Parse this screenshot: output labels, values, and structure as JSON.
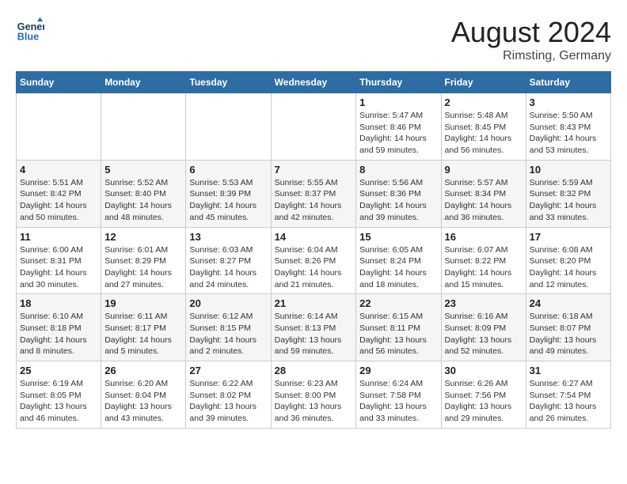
{
  "header": {
    "logo_line1": "General",
    "logo_line2": "Blue",
    "title": "August 2024",
    "subtitle": "Rimsting, Germany"
  },
  "weekdays": [
    "Sunday",
    "Monday",
    "Tuesday",
    "Wednesday",
    "Thursday",
    "Friday",
    "Saturday"
  ],
  "weeks": [
    [
      {
        "day": "",
        "info": ""
      },
      {
        "day": "",
        "info": ""
      },
      {
        "day": "",
        "info": ""
      },
      {
        "day": "",
        "info": ""
      },
      {
        "day": "1",
        "info": "Sunrise: 5:47 AM\nSunset: 8:46 PM\nDaylight: 14 hours\nand 59 minutes."
      },
      {
        "day": "2",
        "info": "Sunrise: 5:48 AM\nSunset: 8:45 PM\nDaylight: 14 hours\nand 56 minutes."
      },
      {
        "day": "3",
        "info": "Sunrise: 5:50 AM\nSunset: 8:43 PM\nDaylight: 14 hours\nand 53 minutes."
      }
    ],
    [
      {
        "day": "4",
        "info": "Sunrise: 5:51 AM\nSunset: 8:42 PM\nDaylight: 14 hours\nand 50 minutes."
      },
      {
        "day": "5",
        "info": "Sunrise: 5:52 AM\nSunset: 8:40 PM\nDaylight: 14 hours\nand 48 minutes."
      },
      {
        "day": "6",
        "info": "Sunrise: 5:53 AM\nSunset: 8:39 PM\nDaylight: 14 hours\nand 45 minutes."
      },
      {
        "day": "7",
        "info": "Sunrise: 5:55 AM\nSunset: 8:37 PM\nDaylight: 14 hours\nand 42 minutes."
      },
      {
        "day": "8",
        "info": "Sunrise: 5:56 AM\nSunset: 8:36 PM\nDaylight: 14 hours\nand 39 minutes."
      },
      {
        "day": "9",
        "info": "Sunrise: 5:57 AM\nSunset: 8:34 PM\nDaylight: 14 hours\nand 36 minutes."
      },
      {
        "day": "10",
        "info": "Sunrise: 5:59 AM\nSunset: 8:32 PM\nDaylight: 14 hours\nand 33 minutes."
      }
    ],
    [
      {
        "day": "11",
        "info": "Sunrise: 6:00 AM\nSunset: 8:31 PM\nDaylight: 14 hours\nand 30 minutes."
      },
      {
        "day": "12",
        "info": "Sunrise: 6:01 AM\nSunset: 8:29 PM\nDaylight: 14 hours\nand 27 minutes."
      },
      {
        "day": "13",
        "info": "Sunrise: 6:03 AM\nSunset: 8:27 PM\nDaylight: 14 hours\nand 24 minutes."
      },
      {
        "day": "14",
        "info": "Sunrise: 6:04 AM\nSunset: 8:26 PM\nDaylight: 14 hours\nand 21 minutes."
      },
      {
        "day": "15",
        "info": "Sunrise: 6:05 AM\nSunset: 8:24 PM\nDaylight: 14 hours\nand 18 minutes."
      },
      {
        "day": "16",
        "info": "Sunrise: 6:07 AM\nSunset: 8:22 PM\nDaylight: 14 hours\nand 15 minutes."
      },
      {
        "day": "17",
        "info": "Sunrise: 6:08 AM\nSunset: 8:20 PM\nDaylight: 14 hours\nand 12 minutes."
      }
    ],
    [
      {
        "day": "18",
        "info": "Sunrise: 6:10 AM\nSunset: 8:18 PM\nDaylight: 14 hours\nand 8 minutes."
      },
      {
        "day": "19",
        "info": "Sunrise: 6:11 AM\nSunset: 8:17 PM\nDaylight: 14 hours\nand 5 minutes."
      },
      {
        "day": "20",
        "info": "Sunrise: 6:12 AM\nSunset: 8:15 PM\nDaylight: 14 hours\nand 2 minutes."
      },
      {
        "day": "21",
        "info": "Sunrise: 6:14 AM\nSunset: 8:13 PM\nDaylight: 13 hours\nand 59 minutes."
      },
      {
        "day": "22",
        "info": "Sunrise: 6:15 AM\nSunset: 8:11 PM\nDaylight: 13 hours\nand 56 minutes."
      },
      {
        "day": "23",
        "info": "Sunrise: 6:16 AM\nSunset: 8:09 PM\nDaylight: 13 hours\nand 52 minutes."
      },
      {
        "day": "24",
        "info": "Sunrise: 6:18 AM\nSunset: 8:07 PM\nDaylight: 13 hours\nand 49 minutes."
      }
    ],
    [
      {
        "day": "25",
        "info": "Sunrise: 6:19 AM\nSunset: 8:05 PM\nDaylight: 13 hours\nand 46 minutes."
      },
      {
        "day": "26",
        "info": "Sunrise: 6:20 AM\nSunset: 8:04 PM\nDaylight: 13 hours\nand 43 minutes."
      },
      {
        "day": "27",
        "info": "Sunrise: 6:22 AM\nSunset: 8:02 PM\nDaylight: 13 hours\nand 39 minutes."
      },
      {
        "day": "28",
        "info": "Sunrise: 6:23 AM\nSunset: 8:00 PM\nDaylight: 13 hours\nand 36 minutes."
      },
      {
        "day": "29",
        "info": "Sunrise: 6:24 AM\nSunset: 7:58 PM\nDaylight: 13 hours\nand 33 minutes."
      },
      {
        "day": "30",
        "info": "Sunrise: 6:26 AM\nSunset: 7:56 PM\nDaylight: 13 hours\nand 29 minutes."
      },
      {
        "day": "31",
        "info": "Sunrise: 6:27 AM\nSunset: 7:54 PM\nDaylight: 13 hours\nand 26 minutes."
      }
    ]
  ]
}
